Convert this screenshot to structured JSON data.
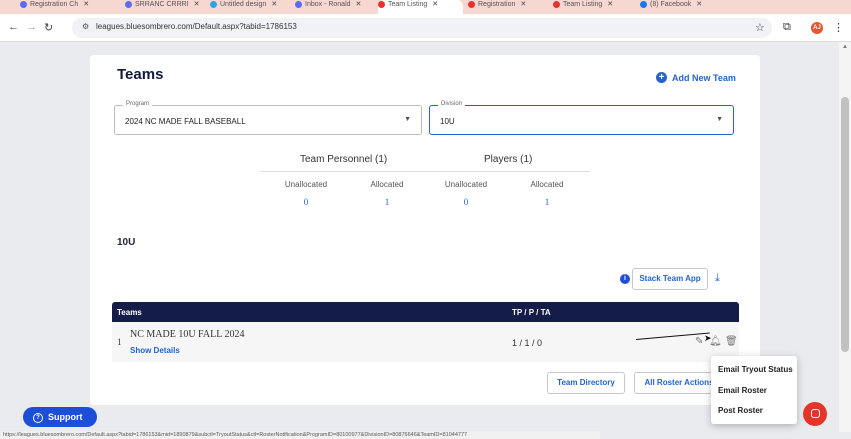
{
  "browser": {
    "tabs": [
      {
        "label": "Registration Ch",
        "color": "#5b6cf0"
      },
      {
        "label": "SRRANC CRRRI",
        "color": "#5b6cf0"
      },
      {
        "label": "Untitled design",
        "color": "#2fa6d9"
      },
      {
        "label": "Inbox - Ronald",
        "color": "#5b6cf0"
      },
      {
        "label": "Team Listing",
        "color": "#e5352b"
      },
      {
        "label": "Registration",
        "color": "#e5352b"
      },
      {
        "label": "Team Listing",
        "color": "#e5352b"
      },
      {
        "label": "(8) Facebook",
        "color": "#1877f2"
      }
    ],
    "url": "leagues.bluesombrero.com/Default.aspx?tabid=1786153",
    "avatar_initials": "AJ",
    "status_url": "https://leagues.bluesombrero.com/Default.aspx?tabid=1786153&mid=1890879&subctl=TryoutStatus&ctl=RosterNotification&ProgramID=80100977&DivisionID=80876646&TeamID=81044777"
  },
  "page": {
    "title": "Teams",
    "add_team_label": "Add New Team",
    "program_legend": "Program",
    "program_value": "2024 NC MADE FALL BASEBALL",
    "division_legend": "Division",
    "division_value": "10U",
    "stats": {
      "personnel_head": "Team Personnel (1)",
      "players_head": "Players (1)",
      "labels": [
        "Unallocated",
        "Allocated",
        "Unallocated",
        "Allocated"
      ],
      "values": [
        "0",
        "1",
        "0",
        "1"
      ]
    },
    "division_label": "10U",
    "stack_team_app_label": "Stack Team App",
    "table": {
      "col_teams": "Teams",
      "col_tpa": "TP / P / TA",
      "rows": [
        {
          "num": "1",
          "name": "NC MADE 10U FALL 2024",
          "details": "Show Details",
          "tpa": "1 / 1 / 0"
        }
      ]
    },
    "team_directory_label": "Team Directory",
    "all_roster_actions_label": "All Roster Actions",
    "menu": [
      "Email Tryout Status",
      "Email Roster",
      "Post Roster"
    ],
    "support_label": "Support"
  },
  "colors": {
    "accent": "#2563c9",
    "header": "#141c4a",
    "chat": "#e5352b"
  }
}
